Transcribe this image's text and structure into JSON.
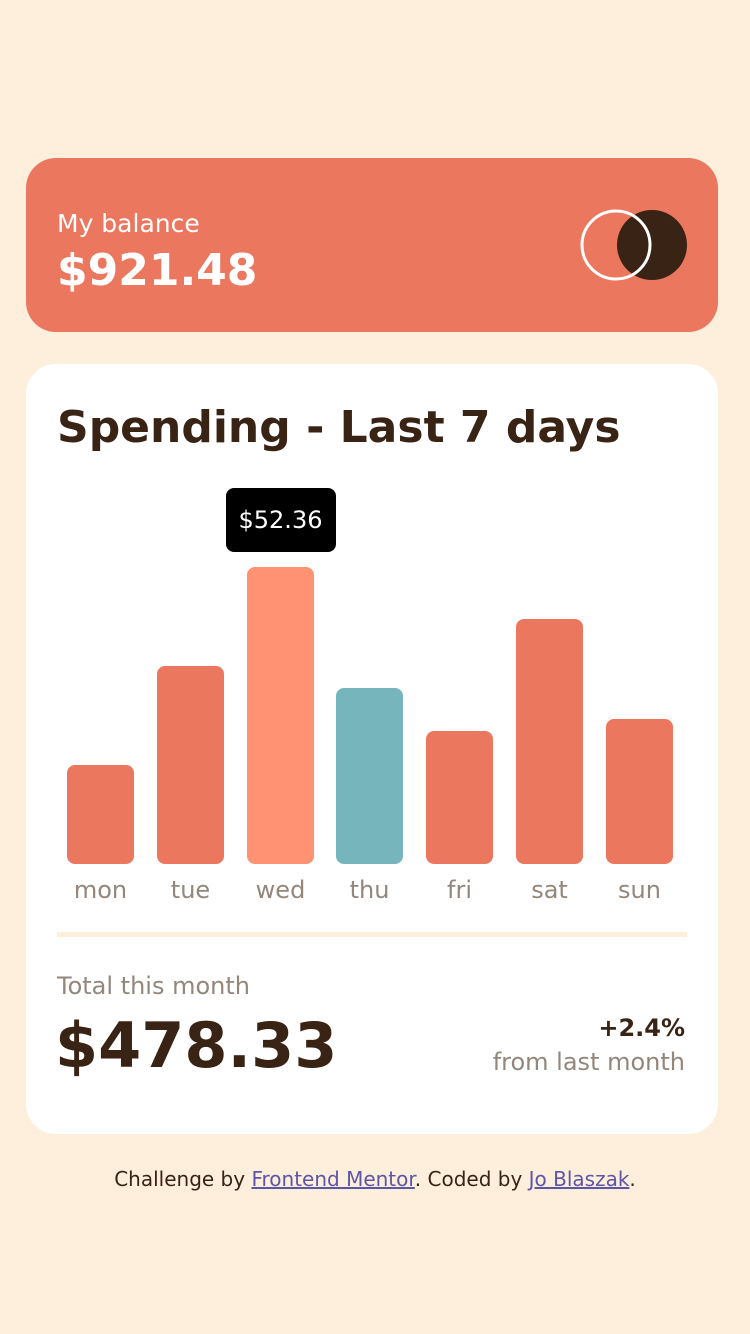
{
  "balance": {
    "label": "My balance",
    "amount": "$921.48"
  },
  "logo": {
    "icon": "two-circles-logo-icon"
  },
  "spending": {
    "title": "Spending - Last 7 days",
    "tooltip": "$52.36",
    "active_day": "wed",
    "hover_day": "thu"
  },
  "chart_data": {
    "type": "bar",
    "categories": [
      "mon",
      "tue",
      "wed",
      "thu",
      "fri",
      "sat",
      "sun"
    ],
    "values": [
      17.45,
      34.91,
      52.36,
      31.07,
      23.39,
      43.28,
      25.48
    ],
    "ylim": [
      0,
      52.36
    ],
    "grid": false
  },
  "total": {
    "label": "Total this month",
    "amount": "$478.33",
    "change": "+2.4%",
    "change_caption": "from last month"
  },
  "attribution": {
    "prefix": "Challenge by",
    "link1": "Frontend Mentor",
    "middle": ". Coded by",
    "link2": "Jo Blaszak",
    "suffix": "."
  },
  "colors": {
    "background": "#FEEEDC",
    "balance_card": "#EC775F",
    "bar": "#EC775F",
    "bar_active": "#FF9273",
    "bar_hover": "#76B5BC",
    "dark": "#382314",
    "muted": "#93867B",
    "white": "#FFFFFF"
  }
}
